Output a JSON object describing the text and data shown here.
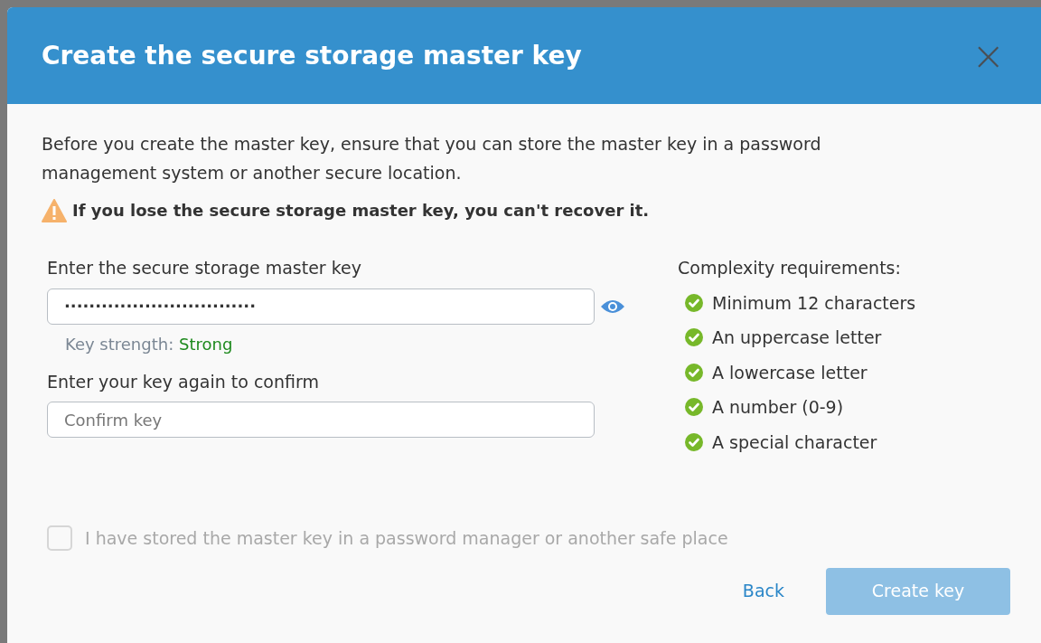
{
  "dialog": {
    "title": "Create the secure storage master key",
    "close": "×"
  },
  "intro": "Before you create the master key, ensure that you can store the master key in a password management system or another secure location.",
  "warning": "If you lose the secure storage master key, you can't recover it.",
  "key_field": {
    "label": "Enter the secure storage master key",
    "value": "·······························"
  },
  "strength": {
    "label": "Key strength:",
    "value": "Strong"
  },
  "confirm_field": {
    "label": "Enter your key again to confirm",
    "placeholder": "Confirm key"
  },
  "requirements": {
    "title": "Complexity requirements:",
    "items": [
      {
        "text": "Minimum 12 characters",
        "met": true
      },
      {
        "text": "An uppercase letter",
        "met": true
      },
      {
        "text": "A lowercase letter",
        "met": true
      },
      {
        "text": "A number (0-9)",
        "met": true
      },
      {
        "text": "A special character",
        "met": true
      }
    ]
  },
  "stored_checkbox": {
    "label": "I have stored the master key in a password manager or another safe place",
    "checked": false,
    "disabled": true
  },
  "buttons": {
    "back": "Back",
    "create": {
      "label": "Create key",
      "disabled": true
    }
  }
}
